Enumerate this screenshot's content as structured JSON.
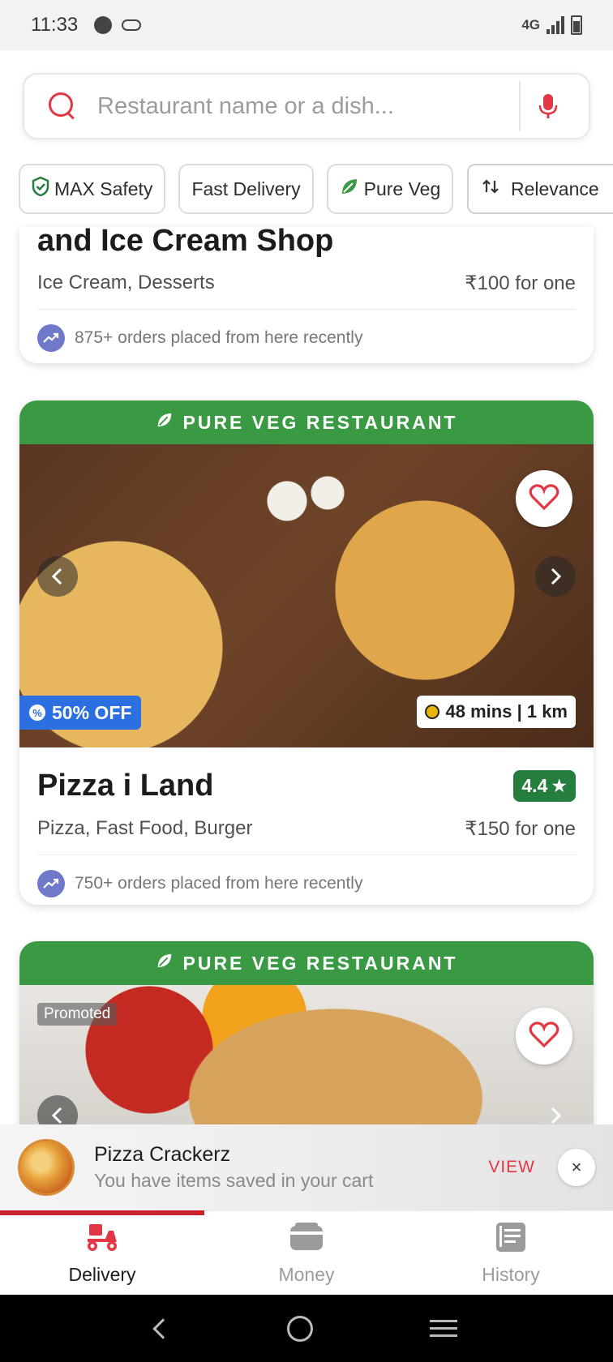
{
  "status_bar": {
    "time": "11:33",
    "network": "4G"
  },
  "search": {
    "placeholder": "Restaurant name or a dish..."
  },
  "filters": [
    {
      "label": "MAX Safety",
      "icon": "shield-check-icon"
    },
    {
      "label": "Fast Delivery"
    },
    {
      "label": "Pure Veg",
      "icon": "leaf-icon"
    }
  ],
  "sort": {
    "label": "Relevance",
    "icon": "sort-arrows-icon"
  },
  "restaurants": [
    {
      "name": "and Ice Cream Shop",
      "cuisines": "Ice Cream, Desserts",
      "price": "₹100 for one",
      "orders": "875+ orders placed from here recently"
    },
    {
      "banner": "PURE VEG RESTAURANT",
      "name": "Pizza i Land",
      "rating": "4.4",
      "cuisines": "Pizza, Fast Food, Burger",
      "price": "₹150 for one",
      "offer": "50% OFF",
      "eta": "48 mins | 1 km",
      "orders": "750+ orders placed from here recently"
    },
    {
      "banner": "PURE VEG RESTAURANT",
      "tag": "Promoted"
    }
  ],
  "cart": {
    "restaurant": "Pizza Crackerz",
    "message": "You have items saved in your cart",
    "action": "VIEW",
    "close": "×"
  },
  "bottom_nav": [
    {
      "label": "Delivery",
      "active": true
    },
    {
      "label": "Money",
      "active": false
    },
    {
      "label": "History",
      "active": false
    }
  ],
  "colors": {
    "brand_red": "#e23744",
    "veg_green": "#3a9a43",
    "rating_green": "#267e3e",
    "offer_blue": "#2b6fe0"
  }
}
